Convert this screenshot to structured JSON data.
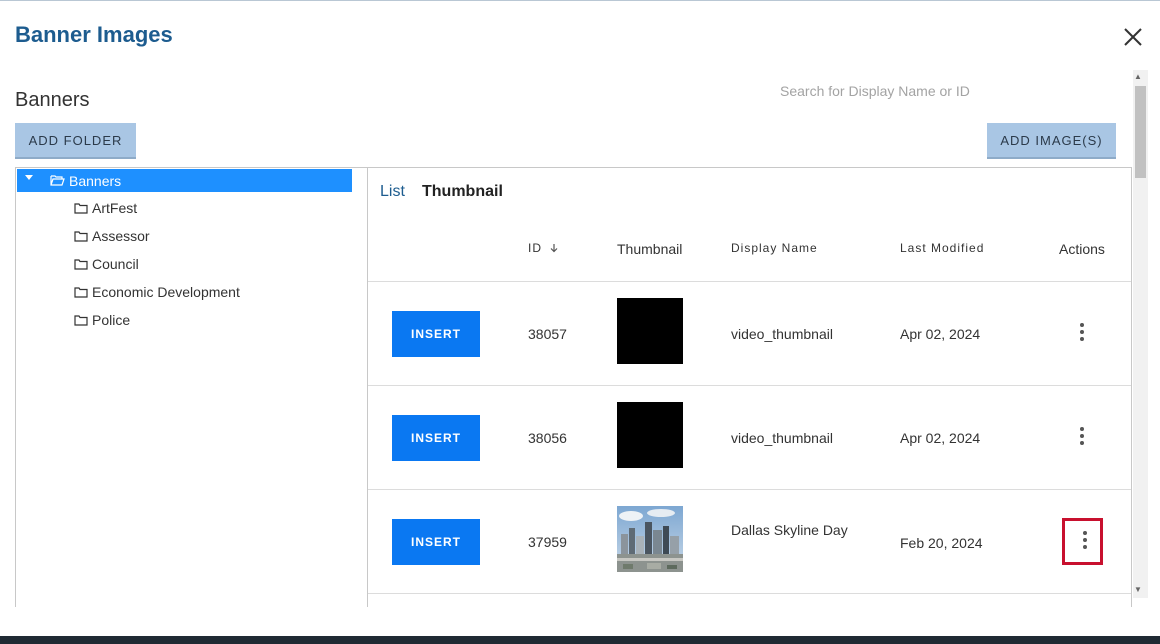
{
  "dialog": {
    "title": "Banner Images"
  },
  "section": {
    "title": "Banners"
  },
  "search": {
    "placeholder": "Search for Display Name or ID"
  },
  "buttons": {
    "add_folder": "ADD FOLDER",
    "add_images": "ADD IMAGE(S)"
  },
  "tree": {
    "root": "Banners",
    "items": [
      "ArtFest",
      "Assessor",
      "Council",
      "Economic Development",
      "Police"
    ]
  },
  "tabs": {
    "list": "List",
    "thumbnail": "Thumbnail"
  },
  "table": {
    "headers": {
      "id": "ID",
      "thumbnail": "Thumbnail",
      "display_name": "Display Name",
      "last_modified": "Last Modified",
      "actions": "Actions"
    },
    "rows": [
      {
        "insert": "INSERT",
        "id": "38057",
        "display_name": "video_thumbnail",
        "last_modified": "Apr 02, 2024",
        "thumb": "black"
      },
      {
        "insert": "INSERT",
        "id": "38056",
        "display_name": "video_thumbnail",
        "last_modified": "Apr 02, 2024",
        "thumb": "black"
      },
      {
        "insert": "INSERT",
        "id": "37959",
        "display_name": "Dallas Skyline Day",
        "last_modified": "Feb 20, 2024",
        "thumb": "skyline-photo"
      }
    ]
  },
  "colors": {
    "accent": "#1d5c8f",
    "selected": "#1e90ff",
    "insert": "#0a78f2",
    "highlight": "#c8102e",
    "button_light": "#a9c6e4"
  }
}
